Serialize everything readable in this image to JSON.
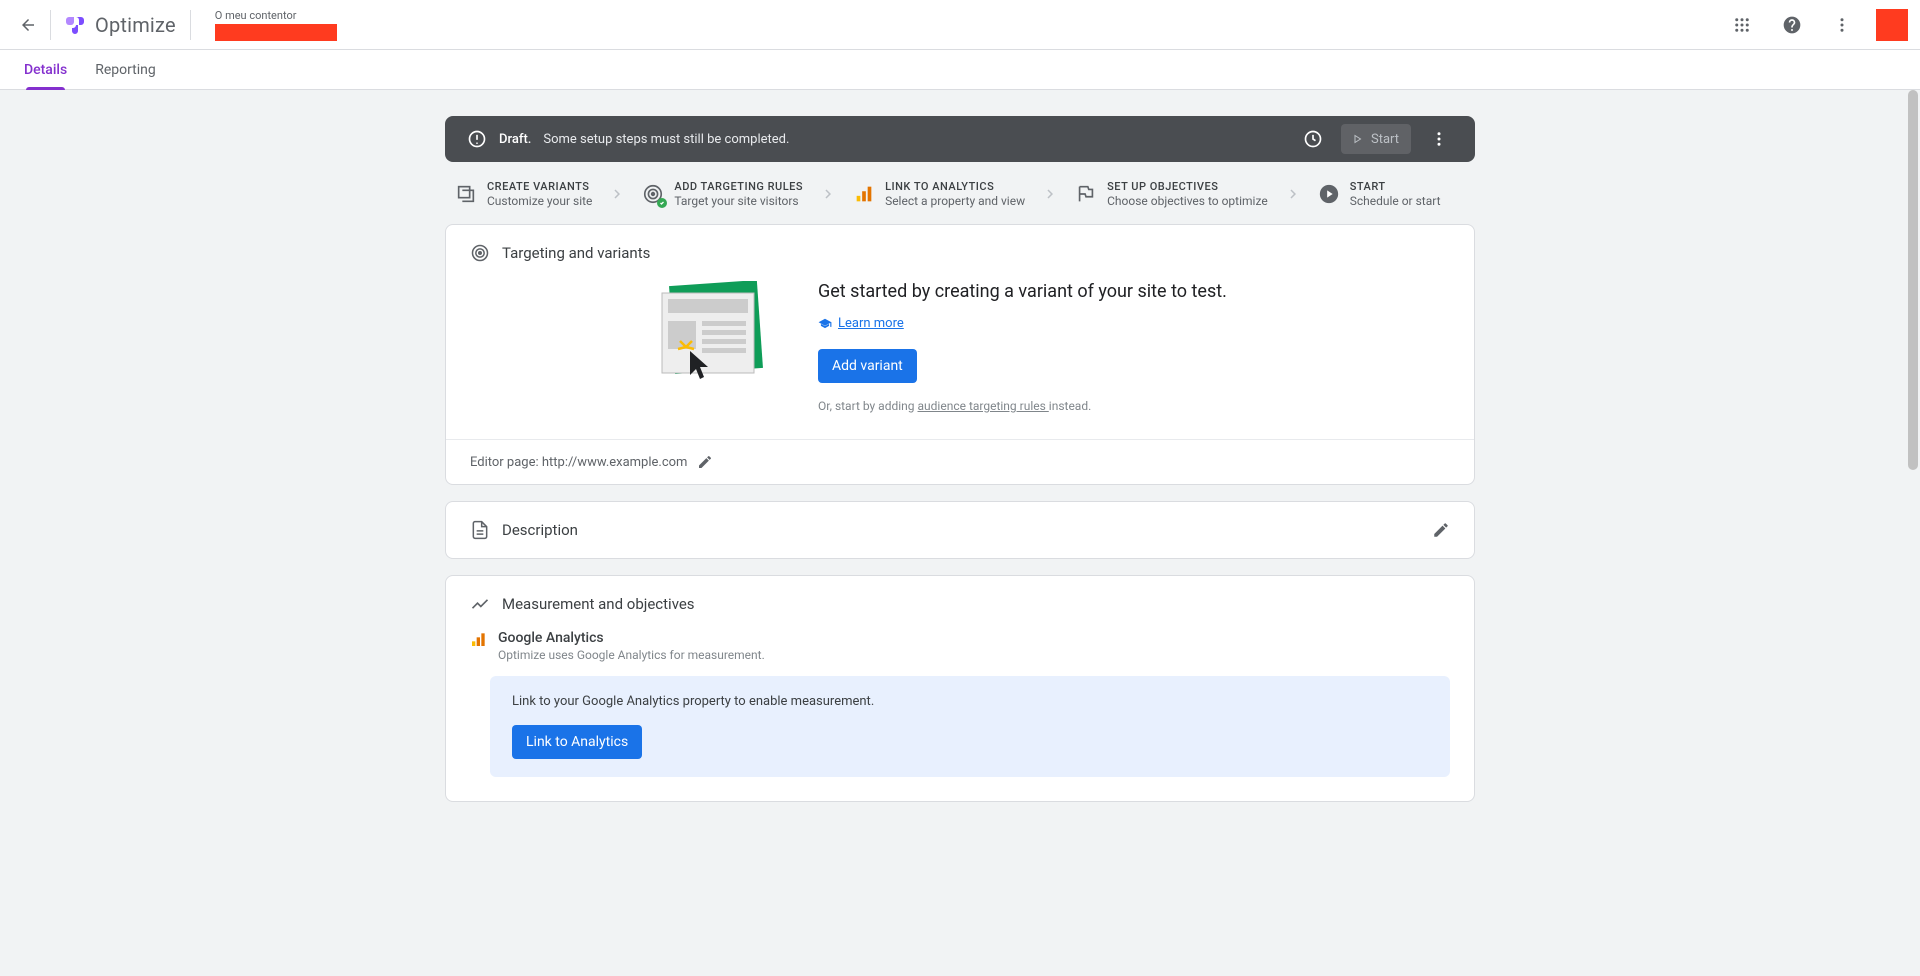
{
  "topbar": {
    "logo_text": "Optimize",
    "container_label": "O meu contentor"
  },
  "tabs": {
    "details": "Details",
    "reporting": "Reporting"
  },
  "status": {
    "draft": "Draft.",
    "message": "Some setup steps must still be completed.",
    "start_label": "Start"
  },
  "steps": [
    {
      "title": "CREATE VARIANTS",
      "sub": "Customize your site"
    },
    {
      "title": "ADD TARGETING RULES",
      "sub": "Target your site visitors"
    },
    {
      "title": "LINK TO ANALYTICS",
      "sub": "Select a property and view"
    },
    {
      "title": "SET UP OBJECTIVES",
      "sub": "Choose objectives to optimize"
    },
    {
      "title": "START",
      "sub": "Schedule or start"
    }
  ],
  "variants": {
    "section_title": "Targeting and variants",
    "intro": "Get started by creating a variant of your site to test.",
    "learn_more": "Learn more",
    "add_variant": "Add variant",
    "or_prefix": "Or, start by adding ",
    "or_link": "audience targeting rules ",
    "or_suffix": "instead.",
    "editor_page_label": "Editor page: ",
    "editor_page_url": "http://www.example.com"
  },
  "description": {
    "title": "Description"
  },
  "measurement": {
    "title": "Measurement and objectives",
    "ga_title": "Google Analytics",
    "ga_sub": "Optimize uses Google Analytics for measurement.",
    "banner_text": "Link to your Google Analytics property to enable measurement.",
    "link_btn": "Link to Analytics"
  }
}
